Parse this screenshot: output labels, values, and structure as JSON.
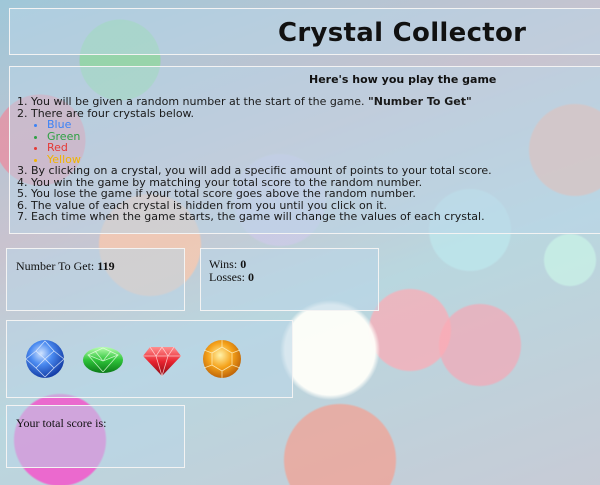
{
  "header": {
    "title": "Crystal Collector"
  },
  "instructions": {
    "heading": "Here's how you play the game",
    "step1_text": "1. You will be given a random number at the start of the game. ",
    "step1_bold": "\"Number To Get\"",
    "step2": "2. There are four crystals below.",
    "crystal_names": [
      "Blue",
      "Green",
      "Red",
      "Yellow"
    ],
    "step3": "3. By clicking on a crystal, you will add a specific amount of points to your total score.",
    "step4": "4. You win the game by matching your total score to the random number.",
    "step5": "5. You lose the game if your total score goes above the random number.",
    "step6": "6. The value of each crystal is hidden from you until you click on it.",
    "step7": "7. Each time when the game starts, the game will change the values of each crystal."
  },
  "target": {
    "label": "Number To Get: ",
    "value": "119"
  },
  "record": {
    "wins_label": "Wins: ",
    "wins": "0",
    "losses_label": "Losses: ",
    "losses": "0"
  },
  "crystals": [
    {
      "name": "Blue",
      "icon": "blue-crystal-icon",
      "color": "#3a78e8"
    },
    {
      "name": "Green",
      "icon": "green-crystal-icon",
      "color": "#2fbf3a"
    },
    {
      "name": "Red",
      "icon": "red-crystal-icon",
      "color": "#e8242f"
    },
    {
      "name": "Yellow",
      "icon": "yellow-crystal-icon",
      "color": "#f39a14"
    }
  ],
  "score": {
    "label": "Your total score is:"
  }
}
